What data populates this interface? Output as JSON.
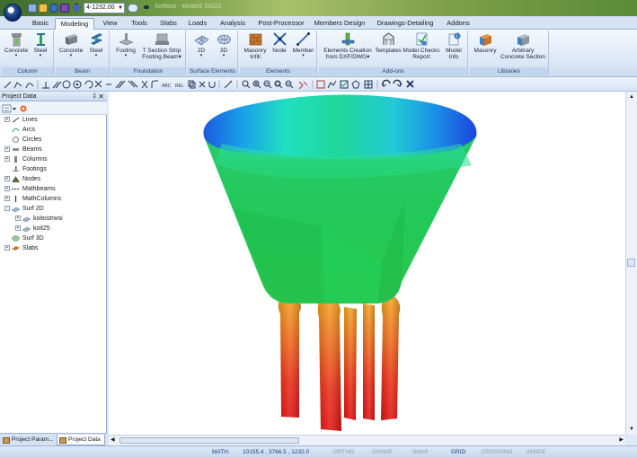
{
  "window": {
    "title": "Softfoot - Model3 StS22",
    "qat_combo_value": "4-1232.00"
  },
  "tabs": [
    {
      "label": "Basic",
      "active": false
    },
    {
      "label": "Modeling",
      "active": true
    },
    {
      "label": "View",
      "active": false
    },
    {
      "label": "Tools",
      "active": false
    },
    {
      "label": "Slabs",
      "active": false
    },
    {
      "label": "Loads",
      "active": false
    },
    {
      "label": "Analysis",
      "active": false
    },
    {
      "label": "Post-Processor",
      "active": false
    },
    {
      "label": "Members Design",
      "active": false
    },
    {
      "label": "Drawings-Detailing",
      "active": false
    },
    {
      "label": "Addons",
      "active": false
    }
  ],
  "ribbon": {
    "column": {
      "label": "Column",
      "concrete": "Concrete",
      "steel": "Steel"
    },
    "beam": {
      "label": "Beam",
      "concrete": "Concrete",
      "steel": "Steel"
    },
    "foundation": {
      "label": "Foundation",
      "footing": "Footing",
      "tsection_line1": "T Section Strip",
      "tsection_line2": "Footing Beam"
    },
    "surface": {
      "label": "Surface Elements",
      "b2d": "2D",
      "b3d": "3D"
    },
    "elements": {
      "label": "Elements",
      "masonry_line1": "Masonry",
      "masonry_line2": "Infill",
      "node": "Node",
      "member": "Member"
    },
    "addons": {
      "label": "Add-ons",
      "creation_line1": "Elements Creation",
      "creation_line2": "from DXF/DWG",
      "templates": "Templates",
      "checks_line1": "Model Checks",
      "checks_line2": "Report",
      "info_line1": "Model",
      "info_line2": "Info"
    },
    "libraries": {
      "label": "Libraries",
      "masonry": "Masonry",
      "arbitrary_line1": "Arbitrary",
      "arbitrary_line2": "Concrete Section"
    }
  },
  "panel": {
    "title": "Project Data",
    "pin_glyph": "‡",
    "close_glyph": "✕",
    "tree": [
      {
        "label": "Lines",
        "expander": "+",
        "icon": "line-icon"
      },
      {
        "label": "Arcs",
        "expander": "",
        "icon": "arc-icon"
      },
      {
        "label": "Circles",
        "expander": "",
        "icon": "circle-icon"
      },
      {
        "label": "Beams",
        "expander": "+",
        "icon": "beam-icon"
      },
      {
        "label": "Columns",
        "expander": "+",
        "icon": "column-icon"
      },
      {
        "label": "Footings",
        "expander": "",
        "icon": "footing-icon"
      },
      {
        "label": "Nodes",
        "expander": "+",
        "icon": "node-icon"
      },
      {
        "label": "Mathbeams",
        "expander": "+",
        "icon": "mathbeam-icon"
      },
      {
        "label": "MathColumns",
        "expander": "+",
        "icon": "mathcolumn-icon"
      },
      {
        "label": "Surf 2D",
        "expander": "−",
        "icon": "surf2d-icon"
      },
      {
        "label": "koitostrwsi",
        "expander": "+",
        "icon": "surf-item-icon",
        "indent": 1
      },
      {
        "label": "koit25",
        "expander": "+",
        "icon": "surf-item-icon",
        "indent": 1
      },
      {
        "label": "Surf 3D",
        "expander": "",
        "icon": "surf3d-icon"
      },
      {
        "label": "Slabs",
        "expander": "+",
        "icon": "slab-icon"
      }
    ],
    "bottom_tabs": [
      {
        "label": "Project Param...",
        "active": false
      },
      {
        "label": "Project Data",
        "active": true
      }
    ]
  },
  "statusbar": {
    "math": "MATH.",
    "coords": "10155.4 , 3766.5 , 1232.0",
    "ortho": "ORTHO",
    "osnap": "OSNAP",
    "snap": "SNAP",
    "grid": "GRID",
    "crossing": "CROSSING",
    "inside": "INSIDE"
  },
  "colors": {
    "accent": "#2b579a",
    "ribbon_bg": "#dbe7f5",
    "tab_active": "#f4f8fd"
  }
}
